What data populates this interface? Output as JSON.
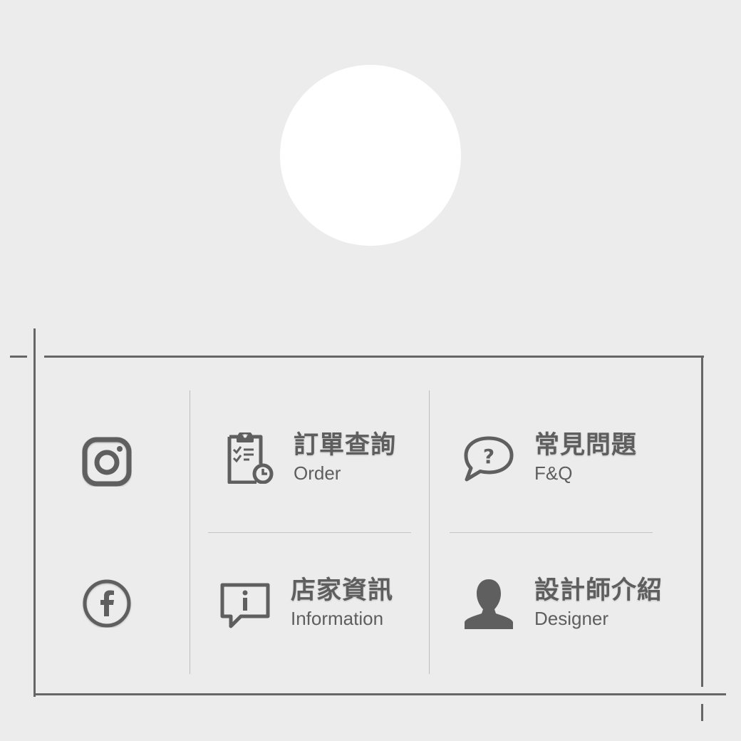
{
  "colors": {
    "background": "#ececec",
    "frame": "#666666",
    "icon": "#5f5f5f",
    "text": "#5e5e5e",
    "avatar": "#ffffff"
  },
  "social": [
    {
      "name": "instagram",
      "icon": "instagram-icon"
    },
    {
      "name": "facebook",
      "icon": "facebook-icon"
    }
  ],
  "menu": {
    "order": {
      "zh": "訂單查詢",
      "en": "Order",
      "icon": "clipboard-clock-icon"
    },
    "faq": {
      "zh": "常見問題",
      "en": "F&Q",
      "icon": "question-bubble-icon"
    },
    "info": {
      "zh": "店家資訊",
      "en": "Information",
      "icon": "info-bubble-icon"
    },
    "designer": {
      "zh": "設計師介紹",
      "en": "Designer",
      "icon": "person-icon"
    }
  }
}
